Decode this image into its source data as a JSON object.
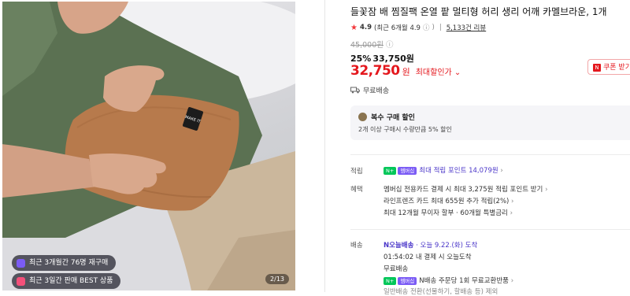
{
  "image": {
    "badge_repurchase": "최근 3개월간 76명 재구매",
    "badge_best": "최근 3일간 판매 BEST 상품",
    "pager": "2/13",
    "pillow_label": "MAKE IT"
  },
  "product": {
    "title": "들꽃잠 배 찜질팩 온열 팥 멀티형 허리 생리 어깨 카멜브라운, 1개",
    "rating_value": "4.9",
    "rating_recent": "(최근 6개월 4.9",
    "review_count": "5,133건 리뷰",
    "original_price": "45,000원",
    "discount_pct": "25%",
    "discount_price": "33,750원",
    "final_price": "32,750",
    "final_won": "원",
    "final_label": "최대할인가",
    "coupon_label": "쿠폰 받기",
    "shipping_free": "무료배송"
  },
  "multi_buy": {
    "title": "복수 구매 할인",
    "desc": "2개 이상 구매시 수량만큼 5% 할인"
  },
  "points": {
    "label": "적립",
    "n_badge": "N+",
    "m_badge": "멤버십",
    "text": "최대 적립 포인트 14,079원"
  },
  "benefits": {
    "label": "혜택",
    "line1": "멤버십 전용카드 결제 시 최대 3,275원 적립 포인트 받기",
    "line2": "라인프렌즈 카드 최대 655원 추가 적립(2%)",
    "line3": "최대 12개월 무이자 할부 · 60개월 특별금리"
  },
  "delivery": {
    "label": "배송",
    "today_badge": "N오늘배송",
    "today_text": "· 오늘 9.22.(화) 도착",
    "countdown": "01:54:02 내 결제 시 오늘도착",
    "free": "무료배송",
    "n_badge": "N+",
    "m_badge": "멤버십",
    "n_return": "N배송 주문당 1회 무료교환반품",
    "extra": "일반배송 전환(선물하기, 할배송 등) 제외"
  },
  "colors": {
    "accent_red": "#e4171d",
    "naver_green": "#03c75a",
    "membership_purple": "#7b5cf5"
  }
}
